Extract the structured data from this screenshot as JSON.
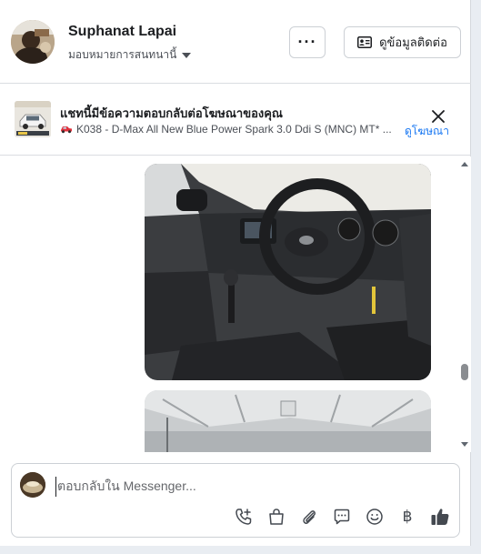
{
  "header": {
    "contact_name": "Suphanat Lapai",
    "assign_label": "มอบหมายการสนทนานี้",
    "more_label": "···",
    "contact_info_label": "ดูข้อมูลติดต่อ"
  },
  "ad_banner": {
    "title": "แชทนี้มีข้อความตอบกลับต่อโฆษณาของคุณ",
    "subtitle": "K038 - D-Max All New Blue Power Spark 3.0 Ddi S (MNC) MT* ...",
    "link_label": "ดูโฆษณา",
    "icon": "car-icon"
  },
  "composer": {
    "placeholder": "ตอบกลับใน Messenger...",
    "tools": [
      "call-add-icon",
      "shopping-bag-icon",
      "paperclip-icon",
      "saved-reply-icon",
      "emoji-icon",
      "baht-icon",
      "thumbs-up-icon"
    ],
    "baht_symbol": "฿"
  },
  "colors": {
    "accent": "#1877f2",
    "border": "#ccd0d5",
    "background": "#e9edf2"
  }
}
